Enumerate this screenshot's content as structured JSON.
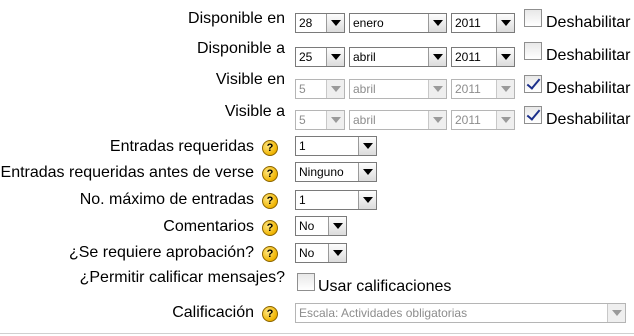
{
  "fields": {
    "available_from": {
      "label": "Disponible en",
      "day": "28",
      "month": "enero",
      "year": "2011",
      "disable_label": "Deshabilitar",
      "disable_checked": false
    },
    "available_to": {
      "label": "Disponible a",
      "day": "25",
      "month": "abril",
      "year": "2011",
      "disable_label": "Deshabilitar",
      "disable_checked": false
    },
    "visible_from": {
      "label": "Visible en",
      "day": "5",
      "month": "abril",
      "year": "2011",
      "disable_label": "Deshabilitar",
      "disable_checked": true
    },
    "visible_to": {
      "label": "Visible a",
      "day": "5",
      "month": "abril",
      "year": "2011",
      "disable_label": "Deshabilitar",
      "disable_checked": true
    },
    "required_entries": {
      "label": "Entradas requeridas",
      "value": "1"
    },
    "required_before_view": {
      "label": "Entradas requeridas antes de verse",
      "value": "Ninguno"
    },
    "max_entries": {
      "label": "No. máximo de entradas",
      "value": "1"
    },
    "comments": {
      "label": "Comentarios",
      "value": "No"
    },
    "approval": {
      "label": "¿Se requiere aprobación?",
      "value": "No"
    },
    "allow_rating": {
      "label": "¿Permitir calificar mensajes?",
      "checkbox_label": "Usar calificaciones",
      "checked": false
    },
    "grade": {
      "label": "Calificación",
      "value": "Escala: Actividades obligatorias"
    }
  },
  "help_icon_glyph": "?"
}
